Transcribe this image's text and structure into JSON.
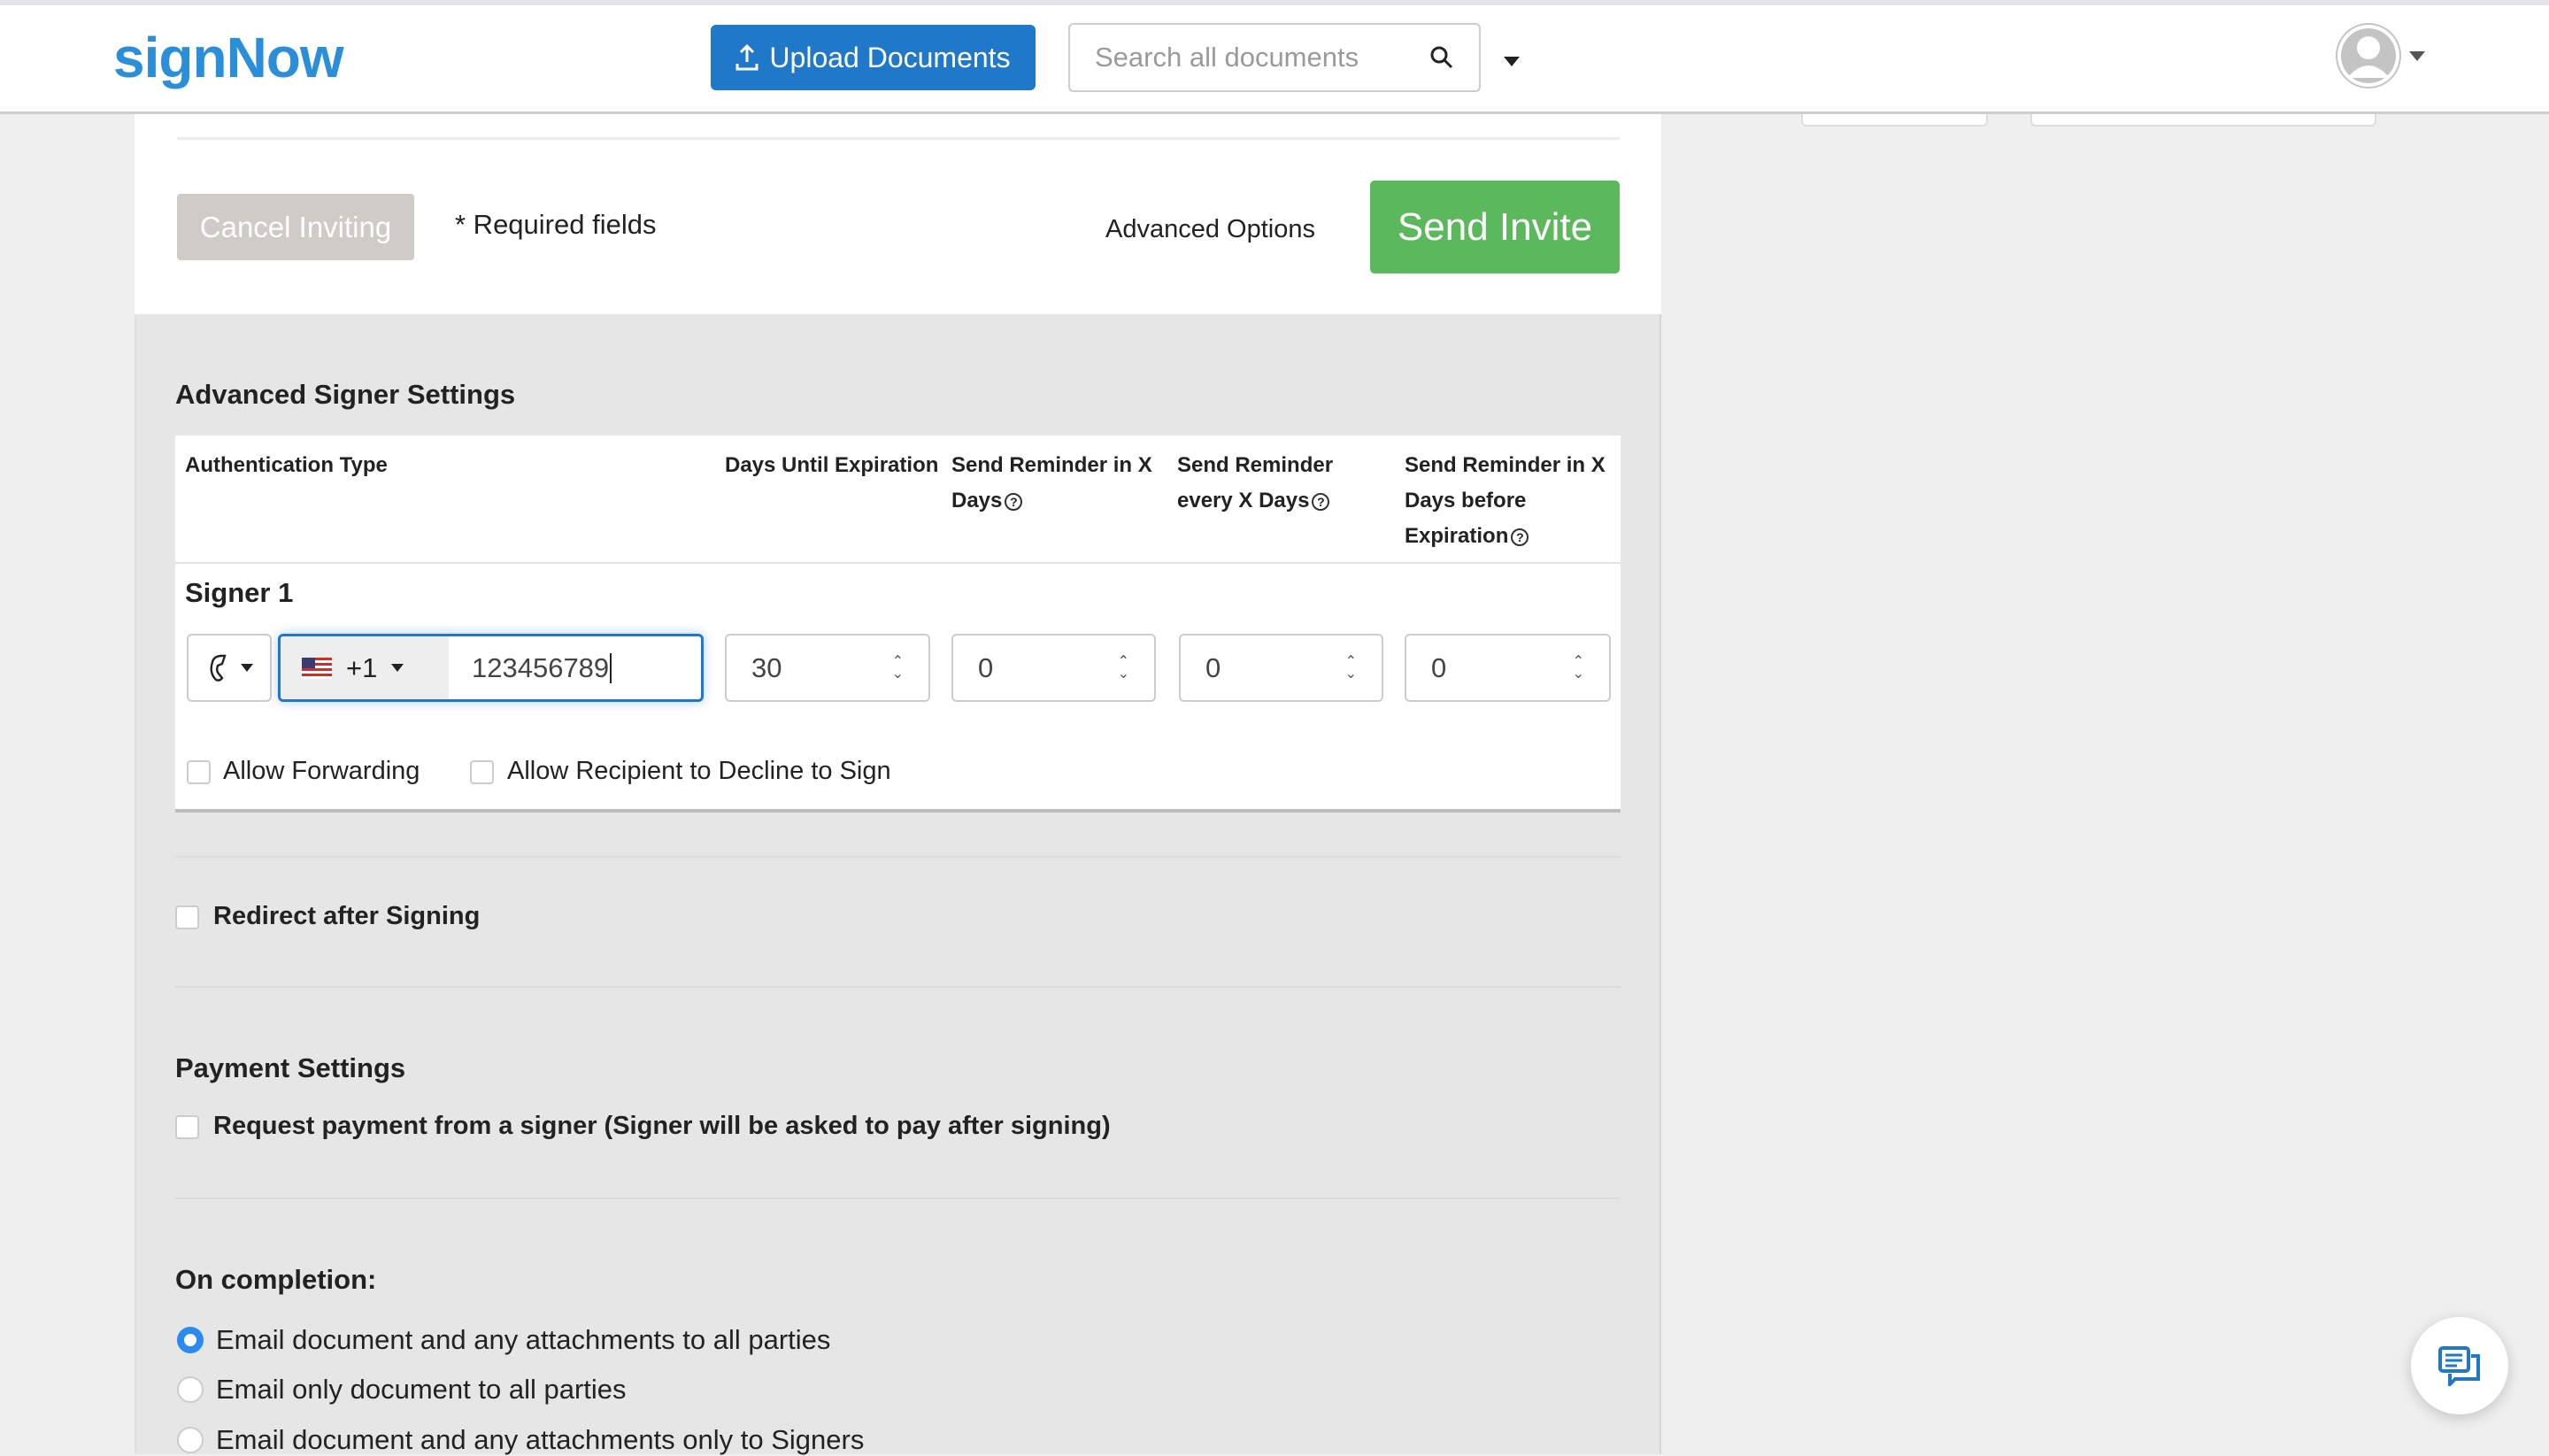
{
  "header": {
    "logo": "signNow",
    "upload_label": "Upload Documents",
    "search_placeholder": "Search all documents"
  },
  "actions": {
    "cancel_label": "Cancel Inviting",
    "required_note": "* Required fields",
    "advanced_options": "Advanced Options",
    "send_label": "Send Invite"
  },
  "advanced": {
    "title": "Advanced Signer Settings",
    "columns": [
      "Authentication Type",
      "Days Until Expiration",
      "Send Reminder in X Days",
      "Send Reminder every X Days",
      "Send Reminder in X Days before Expiration"
    ],
    "signer": {
      "label": "Signer 1",
      "auth_method": "phone",
      "country_code": "+1",
      "phone": "123456789",
      "days_until_expiration": "30",
      "reminder_in": "0",
      "reminder_every": "0",
      "reminder_before": "0",
      "allow_forwarding": "Allow Forwarding",
      "allow_decline": "Allow Recipient to Decline to Sign"
    }
  },
  "redirect": {
    "label": "Redirect after Signing"
  },
  "payment": {
    "title": "Payment Settings",
    "request_label": "Request payment from a signer (Signer will be asked to pay after signing)"
  },
  "completion": {
    "title": "On completion:",
    "options": [
      {
        "label": "Email document and any attachments to all parties",
        "selected": true
      },
      {
        "label": "Email only document to all parties",
        "selected": false
      },
      {
        "label": "Email document and any attachments only to Signers",
        "selected": false
      }
    ]
  },
  "colors": {
    "brand": "#2b8ed8",
    "primary": "#1f78c8",
    "success": "#5cb85c"
  }
}
